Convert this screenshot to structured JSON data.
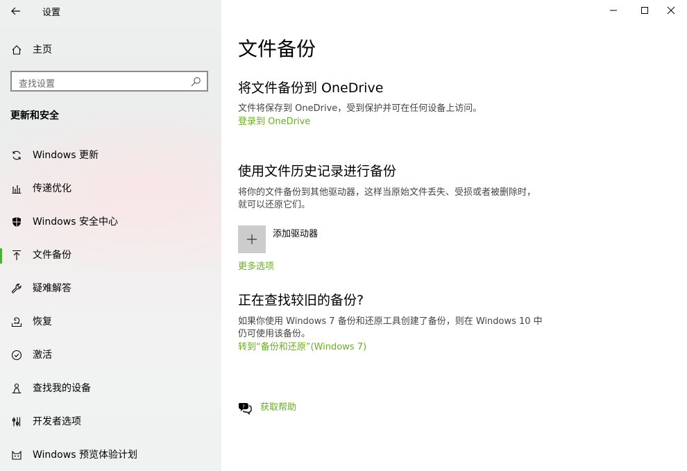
{
  "window": {
    "title": "设置",
    "controls": {
      "minimize": "minimize",
      "maximize": "maximize",
      "close": "close"
    }
  },
  "sidebar": {
    "home_label": "主页",
    "search_placeholder": "查找设置",
    "section_title": "更新和安全",
    "accent_color": "#4caf3b",
    "items": [
      {
        "label": "Windows 更新",
        "icon": "refresh-icon"
      },
      {
        "label": "传递优化",
        "icon": "delivery-optimization-icon"
      },
      {
        "label": "Windows 安全中心",
        "icon": "shield-icon"
      },
      {
        "label": "文件备份",
        "icon": "backup-arrow-up-icon",
        "active": true
      },
      {
        "label": "疑难解答",
        "icon": "wrench-icon"
      },
      {
        "label": "恢复",
        "icon": "recovery-icon"
      },
      {
        "label": "激活",
        "icon": "check-circle-icon"
      },
      {
        "label": "查找我的设备",
        "icon": "person-location-icon"
      },
      {
        "label": "开发者选项",
        "icon": "developer-tools-icon"
      },
      {
        "label": "Windows 预览体验计划",
        "icon": "insider-cat-icon"
      }
    ]
  },
  "main": {
    "page_title": "文件备份",
    "onedrive": {
      "heading": "将文件备份到 OneDrive",
      "description": "文件将保存到 OneDrive，受到保护并可在任何设备上访问。",
      "link": "登录到 OneDrive"
    },
    "file_history": {
      "heading": "使用文件历史记录进行备份",
      "description": "将你的文件备份到其他驱动器，这样当原始文件丢失、受损或者被删除时，就可以还原它们。",
      "add_drive_label": "添加驱动器",
      "more_options": "更多选项"
    },
    "older_backup": {
      "heading": "正在查找较旧的备份?",
      "description": "如果你使用 Windows 7 备份和还原工具创建了备份，则在 Windows 10 中仍可使用该备份。",
      "link": "转到“备份和还原”(Windows 7)"
    },
    "help": {
      "label": "获取帮助"
    },
    "link_color": "#6aad1f"
  }
}
